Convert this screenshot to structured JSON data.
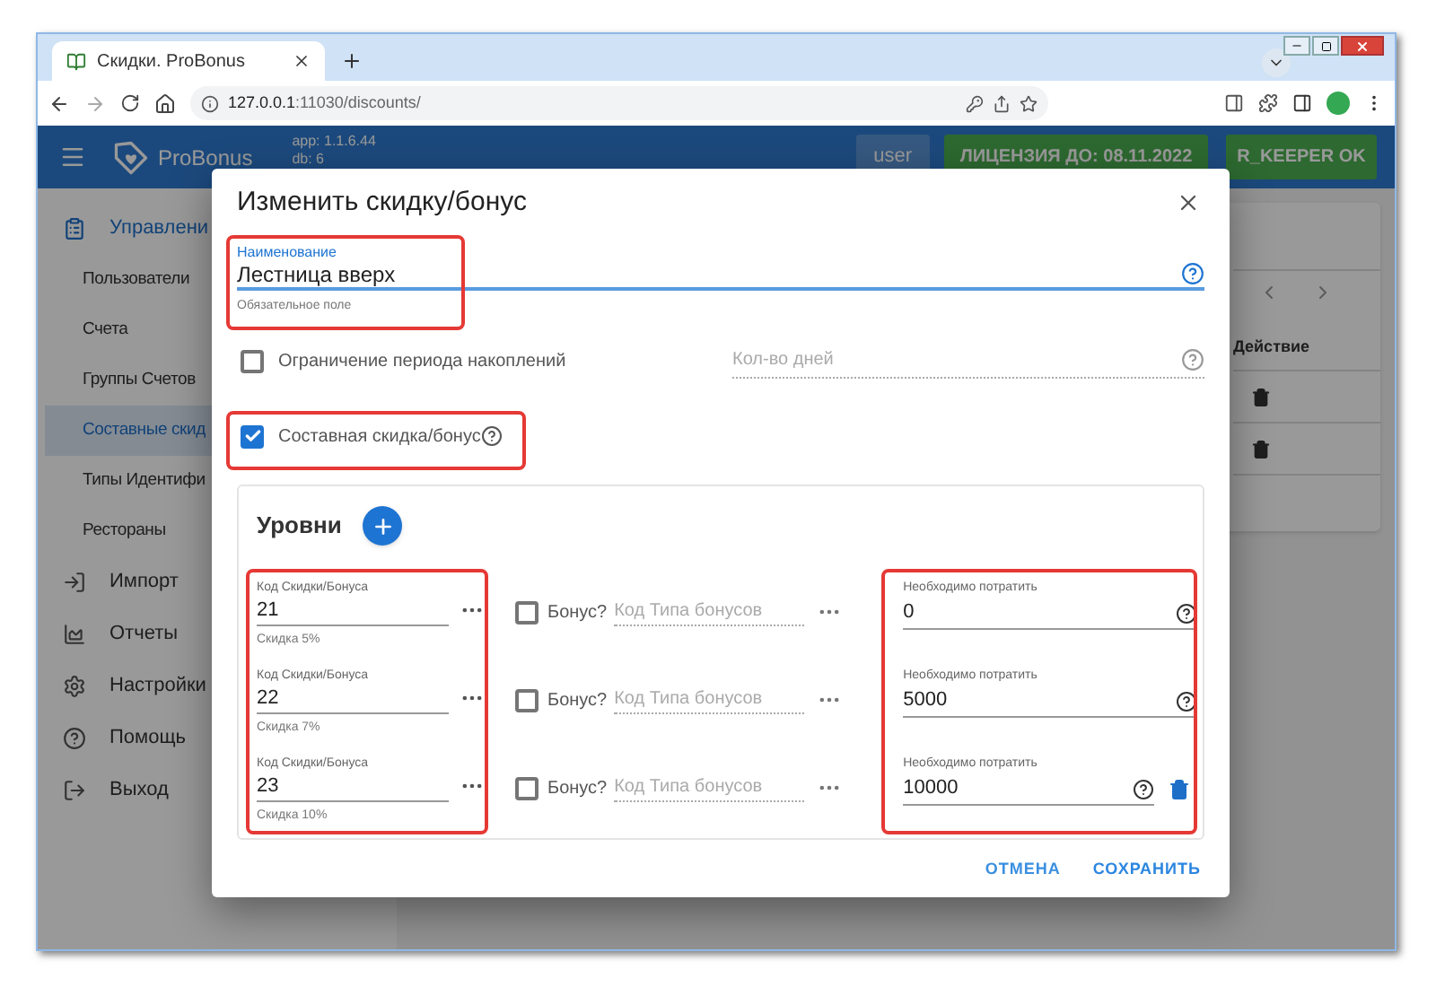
{
  "browser": {
    "tab_title": "Скидки. ProBonus",
    "url_host": "127.0.0.1",
    "url_rest": ":11030/discounts/"
  },
  "header": {
    "brand": "ProBonus",
    "app_version": "app: 1.1.6.44",
    "db_version": "db: 6",
    "user": "user",
    "license": "ЛИЦЕНЗИЯ ДО: 08.11.2022",
    "keeper": "R_KEEPER OK"
  },
  "sidebar": {
    "items": [
      {
        "label": "Управлени",
        "expanded": true,
        "children": [
          {
            "label": "Пользователи",
            "selected": false
          },
          {
            "label": "Счета",
            "selected": false
          },
          {
            "label": "Группы Счетов",
            "selected": false
          },
          {
            "label": "Составные скид",
            "selected": true
          },
          {
            "label": "Типы Идентифи",
            "selected": false
          },
          {
            "label": "Рестораны",
            "selected": false
          }
        ]
      },
      {
        "label": "Импорт",
        "expanded": false
      },
      {
        "label": "Отчеты",
        "expanded": false
      },
      {
        "label": "Настройки",
        "expanded": false
      },
      {
        "label": "Помощь",
        "expanded": false
      },
      {
        "label": "Выход",
        "expanded": false
      }
    ]
  },
  "table": {
    "column_header": "Действие",
    "rows": [
      {
        "kind": "delete"
      },
      {
        "kind": "delete"
      }
    ]
  },
  "dialog": {
    "title": "Изменить скидку/бонус",
    "name_field": {
      "label": "Наименование",
      "value": "Лестница вверх",
      "helper": "Обязательное поле",
      "highlighted": true
    },
    "period_limit": {
      "label": "Ограничение периода накоплений",
      "checked": false,
      "days_placeholder": "Кол-во дней"
    },
    "composite": {
      "label": "Составная скидка/бонус",
      "checked": true,
      "highlighted": true
    },
    "levels": {
      "title": "Уровни",
      "highlight_codes": true,
      "highlight_spend": true,
      "rows": [
        {
          "code_label": "Код Скидки/Бонуса",
          "code": "21",
          "code_helper": "Скидка 5%",
          "bonus_checked": false,
          "bonus_label": "Бонус?",
          "bonus_type_placeholder": "Код Типа бонусов",
          "spend_label": "Необходимо потратить",
          "spend": "0",
          "deletable": false
        },
        {
          "code_label": "Код Скидки/Бонуса",
          "code": "22",
          "code_helper": "Скидка 7%",
          "bonus_checked": false,
          "bonus_label": "Бонус?",
          "bonus_type_placeholder": "Код Типа бонусов",
          "spend_label": "Необходимо потратить",
          "spend": "5000",
          "deletable": false
        },
        {
          "code_label": "Код Скидки/Бонуса",
          "code": "23",
          "code_helper": "Скидка 10%",
          "bonus_checked": false,
          "bonus_label": "Бонус?",
          "bonus_type_placeholder": "Код Типа бонусов",
          "spend_label": "Необходимо потратить",
          "spend": "10000",
          "deletable": true
        }
      ]
    },
    "buttons": [
      {
        "label": "ОТМЕНА",
        "kind": "cancel"
      },
      {
        "label": "СОХРАНИТЬ",
        "kind": "save"
      }
    ]
  }
}
